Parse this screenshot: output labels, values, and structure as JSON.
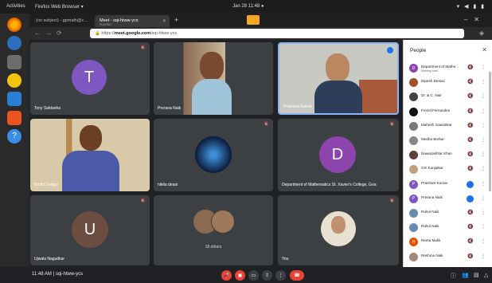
{
  "topbar": {
    "activities": "Activities",
    "app_name": "Firefox Web Browser ▾",
    "clock": "Jan 28  11:48 ●",
    "tray": "▾ ◀ ▮ ▮"
  },
  "browser": {
    "tab1": "(no subject) - gpmath@c…",
    "tab2_title": "Meet - sqi-htww-ycs",
    "tab2_sub": "PLAYING",
    "url_prefix": "https://",
    "url_domain": "meet.google.com",
    "url_path": "/sqi-htww-ycs"
  },
  "tiles": [
    {
      "name": "Tony Saldanha",
      "initial": "T",
      "color": "#7e57c2"
    },
    {
      "name": "Prerana Naik"
    },
    {
      "name": "Prashant Kumar"
    },
    {
      "name": "Bodhi Dangui"
    },
    {
      "name": "nikita desai"
    },
    {
      "name": "Department of Mathematics St. Xavier's College, Goa",
      "initial": "D",
      "color": "#8e44ad"
    },
    {
      "name": "Ujwala Nagudkar",
      "initial": "U",
      "color": "#6d4c41"
    },
    {
      "name": "",
      "others": "18 others"
    },
    {
      "name": "You"
    }
  ],
  "bottombar": {
    "time": "11:48 AM",
    "sep": "|",
    "code": "sqi-htww-ycs"
  },
  "people": {
    "title": "People",
    "items": [
      {
        "name": "Department of Mathe…",
        "sub": "Meeting host",
        "initial": "D",
        "color": "#8e44ad"
      },
      {
        "name": "Dipesh Dessai",
        "initial": "",
        "color": "#a0522d"
      },
      {
        "name": "Dr. & C. Nair",
        "initial": "",
        "color": "#444"
      },
      {
        "name": "Frezel Fernandes",
        "initial": "",
        "color": "#111"
      },
      {
        "name": "Mahesh Gawdekar",
        "initial": "",
        "color": "#777"
      },
      {
        "name": "Medha Borkar",
        "initial": "",
        "color": "#888"
      },
      {
        "name": "Nawazakhtar Khan",
        "initial": "",
        "color": "#5d4037"
      },
      {
        "name": "Om Kunjalkar",
        "initial": "",
        "color": "#c0a080"
      },
      {
        "name": "Prashant Kumar",
        "initial": "P",
        "color": "#7e57c2"
      },
      {
        "name": "Prerana Naik",
        "initial": "P",
        "color": "#7e57c2"
      },
      {
        "name": "Rahul Naik",
        "initial": "",
        "color": "#6a8caf"
      },
      {
        "name": "Rahul Naik",
        "initial": "",
        "color": "#6a8caf"
      },
      {
        "name": "Reeta Malik",
        "initial": "R",
        "color": "#e65100"
      },
      {
        "name": "Reshma Naik",
        "initial": "",
        "color": "#a1887f"
      }
    ]
  }
}
